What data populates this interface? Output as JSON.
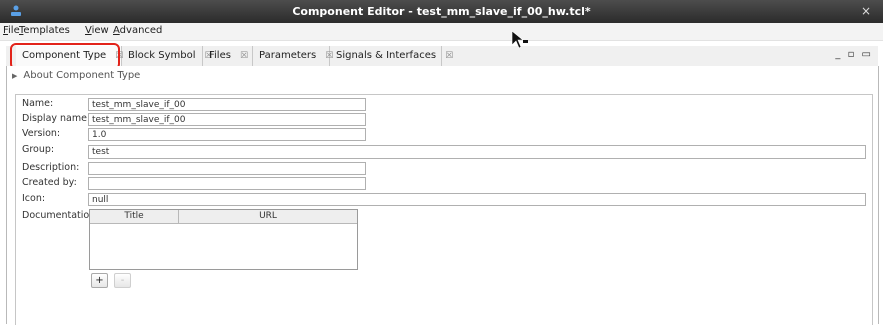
{
  "window": {
    "title": "Component Editor - test_mm_slave_if_00_hw.tcl*",
    "close_glyph": "×"
  },
  "menu": [
    {
      "mnemonic": "F",
      "rest": "ile"
    },
    {
      "mnemonic": "T",
      "rest": "emplates"
    },
    {
      "mnemonic": "V",
      "rest": "iew"
    },
    {
      "mnemonic": "A",
      "rest": "dvanced"
    }
  ],
  "tabs": [
    {
      "label": "Component Type",
      "close": "☒"
    },
    {
      "label": "Block Symbol",
      "close": "☒"
    },
    {
      "label": "Files",
      "close": "☒"
    },
    {
      "label": "Parameters",
      "close": "☒"
    },
    {
      "label": "Signals & Interfaces",
      "close": "☒"
    }
  ],
  "window_controls": "_ ▫ ▭",
  "about": {
    "arrow": "▶",
    "label": "About Component Type"
  },
  "form": {
    "name": {
      "label": "Name:",
      "value": "test_mm_slave_if_00"
    },
    "display_name": {
      "label": "Display name:",
      "value": "test_mm_slave_if_00"
    },
    "version": {
      "label": "Version:",
      "value": "1.0"
    },
    "group": {
      "label": "Group:",
      "value": "test"
    },
    "description": {
      "label": "Description:",
      "value": ""
    },
    "created_by": {
      "label": "Created by:",
      "value": ""
    },
    "icon": {
      "label": "Icon:",
      "value": "null"
    },
    "documentation": {
      "label": "Documentation:",
      "columns": [
        "Title",
        "URL"
      ],
      "rows": []
    }
  },
  "buttons": {
    "add": "+",
    "remove": "-"
  },
  "colors": {
    "titlebar": "#333333",
    "highlight": "#e2231a",
    "background": "#ffffff"
  }
}
